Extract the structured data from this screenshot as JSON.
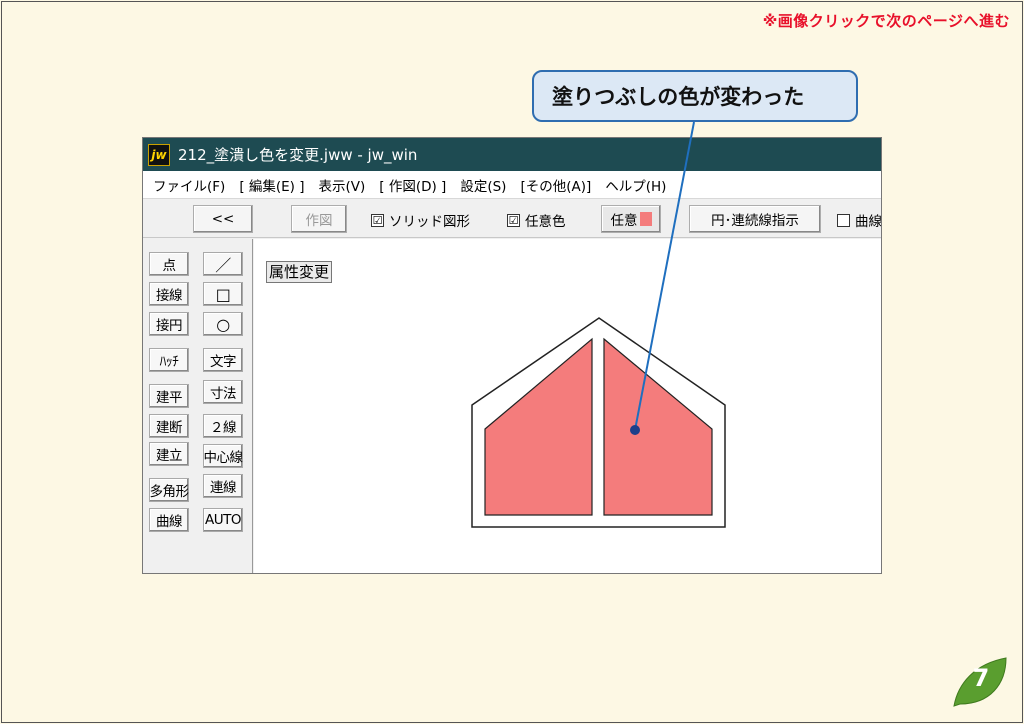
{
  "slide": {
    "top_note": "※画像クリックで次のページへ進む",
    "callout": "塗りつぶしの色が変わった",
    "page_number": "7",
    "accent_color": "#e8102a",
    "leaf_color": "#5a9e2f"
  },
  "window": {
    "icon_text": "jw",
    "title": "212_塗潰し色を変更.jww - jw_win",
    "menu": [
      "ファイル(F)",
      "[ 編集(E) ]",
      "表示(V)",
      "[ 作図(D) ]",
      "設定(S)",
      "[その他(A)]",
      "ヘルプ(H)"
    ],
    "toolbar": {
      "back": "<<",
      "draw": "作図",
      "solid": "ソリッド図形",
      "solid_checked": "☑",
      "any_color": "任意色",
      "any_color_checked": "☑",
      "any_button": "任意",
      "fill_color": "#f47c7c",
      "arc_line": "円･連続線指示",
      "curve": "曲線"
    },
    "left_col1": [
      "点",
      "接線",
      "接円",
      "ﾊｯﾁ",
      "建平",
      "建断",
      "建立",
      "多角形",
      "曲線"
    ],
    "left_col2": [
      "／",
      "□",
      "○",
      "文字",
      "寸法",
      "２線",
      "中心線",
      "連線",
      "AUTO"
    ],
    "canvas_label": "属性変更"
  }
}
